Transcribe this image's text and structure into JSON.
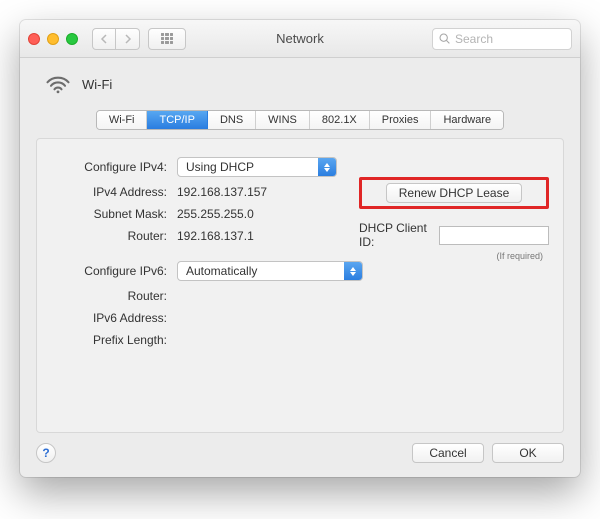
{
  "titlebar": {
    "title": "Network",
    "search_placeholder": "Search"
  },
  "header": {
    "interface_label": "Wi-Fi"
  },
  "tabs": [
    {
      "label": "Wi-Fi"
    },
    {
      "label": "TCP/IP"
    },
    {
      "label": "DNS"
    },
    {
      "label": "WINS"
    },
    {
      "label": "802.1X"
    },
    {
      "label": "Proxies"
    },
    {
      "label": "Hardware"
    }
  ],
  "active_tab_index": 1,
  "ipv4": {
    "configure_label": "Configure IPv4:",
    "configure_value": "Using DHCP",
    "address_label": "IPv4 Address:",
    "address_value": "192.168.137.157",
    "subnet_label": "Subnet Mask:",
    "subnet_value": "255.255.255.0",
    "router_label": "Router:",
    "router_value": "192.168.137.1"
  },
  "dhcp": {
    "renew_button": "Renew DHCP Lease",
    "client_id_label": "DHCP Client ID:",
    "client_id_value": "",
    "required_note": "(If required)"
  },
  "ipv6": {
    "configure_label": "Configure IPv6:",
    "configure_value": "Automatically",
    "router_label": "Router:",
    "router_value": "",
    "address_label": "IPv6 Address:",
    "address_value": "",
    "prefix_label": "Prefix Length:",
    "prefix_value": ""
  },
  "footer": {
    "help_label": "?",
    "cancel_label": "Cancel",
    "ok_label": "OK"
  },
  "colors": {
    "accent": "#2a7de0",
    "highlight_border": "#e02626"
  }
}
